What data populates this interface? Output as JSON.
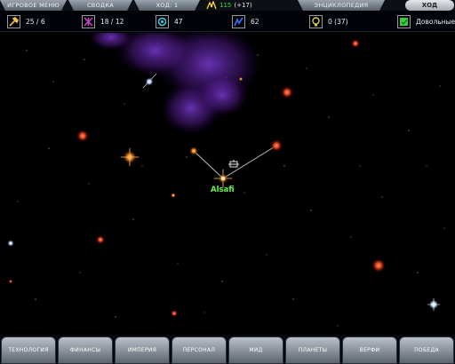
{
  "top_menu": {
    "game_menu": "ИГРОВОЕ МЕНЮ",
    "summary": "СВОДКА",
    "turn_number": "ХОД: 1",
    "research_value": "115",
    "research_bonus": "(+17)",
    "encyclopedia": "ЭНЦИКЛОПЕДИЯ",
    "turn_button": "ХОД"
  },
  "resources": {
    "industry": {
      "value": "25 / 6",
      "color": "#f0c040"
    },
    "defense": {
      "value": "18 / 12",
      "color": "#d040d0"
    },
    "command": {
      "value": "47",
      "color": "#40d0e0"
    },
    "science": {
      "value": "62",
      "color": "#3a6af0"
    },
    "credits": {
      "value": "0 (37)",
      "color": "#d8d040"
    },
    "morale": {
      "value": "Довольные",
      "color": "#40c840"
    }
  },
  "map": {
    "system_name": "Alsafi"
  },
  "bottom_nav": {
    "technology": "ТЕХНОЛОГИЯ",
    "finance": "ФИНАНСЫ",
    "empire": "ИМПЕРИЯ",
    "personnel": "ПЕРСОНАЛ",
    "mid": "МИД",
    "planets": "ПЛАНЕТЫ",
    "shipyards": "ВЕРФИ",
    "victory": "ПОБЕДА"
  }
}
